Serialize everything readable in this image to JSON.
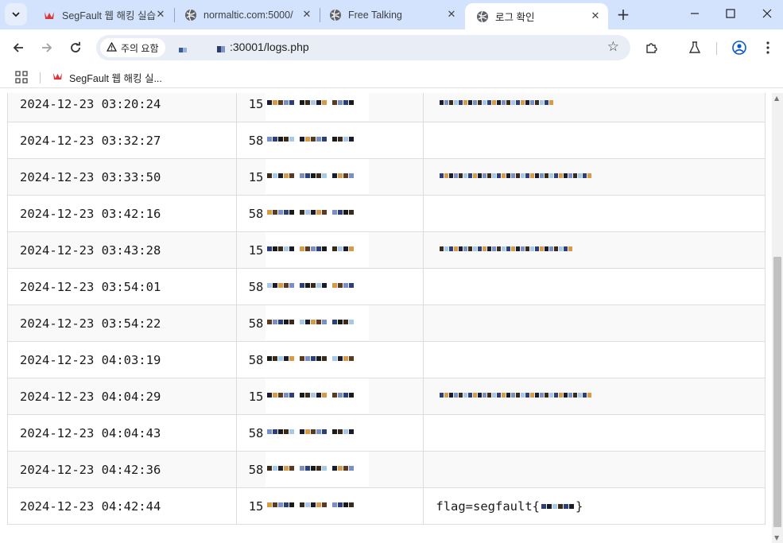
{
  "browser": {
    "tabs": [
      {
        "title": "SegFault 웹 해킹 실습",
        "favicon": "segfault-crown-icon",
        "active": false
      },
      {
        "title": "normaltic.com:5000/",
        "favicon": "globe-icon",
        "active": false
      },
      {
        "title": "Free Talking",
        "favicon": "globe-icon",
        "active": false
      },
      {
        "title": "로그 확인",
        "favicon": "globe-icon",
        "active": true
      }
    ],
    "new_tab_label": "+",
    "security_chip": "주의 요함",
    "url_visible": ":30001/logs.php",
    "bookmarks": [
      {
        "title": "SegFault 웹 해킹 실...",
        "favicon": "segfault-crown-icon"
      }
    ]
  },
  "logs": [
    {
      "time": "2024-12-23 03:20:24",
      "ip_prefix": "15",
      "data": ""
    },
    {
      "time": "2024-12-23 03:32:27",
      "ip_prefix": "58",
      "data": ""
    },
    {
      "time": "2024-12-23 03:33:50",
      "ip_prefix": "15",
      "data": ""
    },
    {
      "time": "2024-12-23 03:42:16",
      "ip_prefix": "58",
      "data": ""
    },
    {
      "time": "2024-12-23 03:43:28",
      "ip_prefix": "15",
      "data": ""
    },
    {
      "time": "2024-12-23 03:54:01",
      "ip_prefix": "58",
      "data": ""
    },
    {
      "time": "2024-12-23 03:54:22",
      "ip_prefix": "58",
      "data": ""
    },
    {
      "time": "2024-12-23 04:03:19",
      "ip_prefix": "58",
      "data": ""
    },
    {
      "time": "2024-12-23 04:04:29",
      "ip_prefix": "15",
      "data": ""
    },
    {
      "time": "2024-12-23 04:04:43",
      "ip_prefix": "58",
      "data": ""
    },
    {
      "time": "2024-12-23 04:42:36",
      "ip_prefix": "58",
      "data": ""
    },
    {
      "time": "2024-12-23 04:42:44",
      "ip_prefix": "15",
      "data": "flag=segfault{",
      "data_suffix": "}"
    }
  ],
  "colors": {
    "tab_strip": "#d3e3fd",
    "omnibox": "#e9eef6",
    "row_odd": "#f9f9f9",
    "row_even": "#ffffff",
    "border": "#dddddd",
    "scroll_thumb": "#c1c1c1"
  }
}
